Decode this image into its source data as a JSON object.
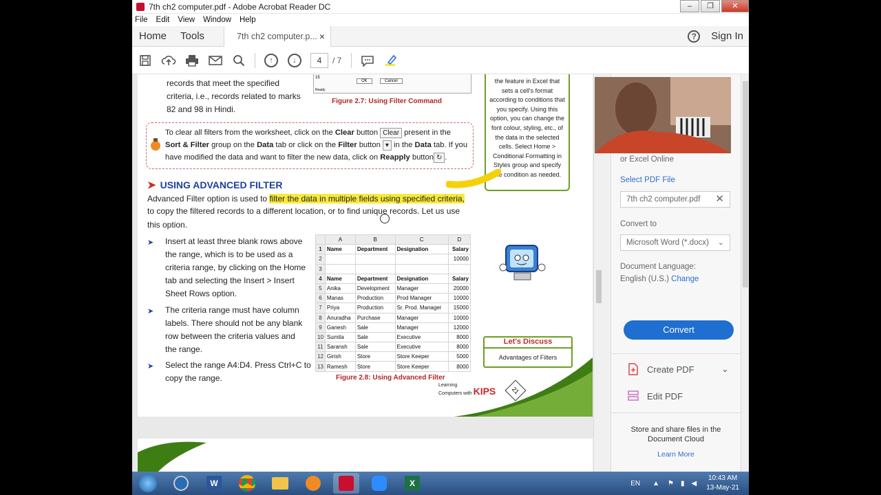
{
  "window": {
    "title": "7th ch2 computer.pdf - Adobe Acrobat Reader DC",
    "min": "–",
    "max": "❐",
    "close": "✕"
  },
  "menu": [
    "File",
    "Edit",
    "View",
    "Window",
    "Help"
  ],
  "tabs": {
    "home": "Home",
    "tools": "Tools",
    "doc_tab": "7th ch2 computer.p...",
    "doc_tab_close": "×",
    "help": "?",
    "sign_in": "Sign In"
  },
  "toolbar": {
    "page_current": "4",
    "page_total": "/ 7"
  },
  "document": {
    "top_lines": [
      "records that meet the specified",
      "criteria, i.e., records related to marks",
      "82 and 98 in Hindi."
    ],
    "fig27_caption": "Figure 2.7:  Using Filter Command",
    "fig27_ok": "OK",
    "fig27_cancel": "Cancel",
    "fig27_row": "15",
    "fig27_ready": "Ready",
    "tip": {
      "line1_a": "To clear all filters from the worksheet, click on the ",
      "line1_b": "Clear",
      "line1_c": " button ",
      "clear_chip": "Clear",
      "line1_d": " present in the",
      "line2_a": "Sort & Filter",
      "line2_b": " group on the ",
      "line2_c": "Data",
      "line2_d": " tab or click on the ",
      "line2_e": "Filter",
      "line2_f": " button ",
      "line2_g": " in the ",
      "line2_h": "Data",
      "line2_i": " tab. If you",
      "line3_a": "have modified the data and want to filter the new data, click on ",
      "line3_b": "Reapply",
      "line3_c": " button",
      "line3_d": "."
    },
    "heading": "USING ADVANCED FILTER",
    "para_a": "Advanced Filter option is used to ",
    "para_hl": "filter the data in multiple fields using specified criteria,",
    "para_b": "to copy the filtered records to a different location, or to find unique records. Let us use",
    "para_c": "this option.",
    "bullet1": [
      "Insert at least three blank rows above",
      "the range, which is to be used as a",
      "criteria range, by clicking on the Home",
      "tab and selecting the Insert > Insert",
      "Sheet Rows option."
    ],
    "bullet2": [
      "The criteria range must have column",
      "labels. There should not be any blank",
      "row between the criteria values and",
      "the range."
    ],
    "bullet3": [
      "Select the range A4:D4. Press Ctrl+C to",
      "copy the range."
    ],
    "fig28_caption": "Figure 2.8:  Using Advanced Filter",
    "sidebox": "the feature in Excel that sets a cell's format according to conditions that you specify. Using this option, you can change the font colour, styling, etc., of the data in the selected cells. Select Home > Conditional Formatting in Styles group and specify the condition as needed.",
    "discuss_title": "Let's Discuss",
    "discuss_body": "Advantages of Filters",
    "footer_brand_a": "Learning",
    "footer_brand_b": "Computers with",
    "footer_brand_c": "KIPS",
    "page_no": "21"
  },
  "excel": {
    "cols": [
      "",
      "A",
      "B",
      "C",
      "D"
    ],
    "rows": [
      [
        "1",
        "Name",
        "Department",
        "Designation",
        "Salary"
      ],
      [
        "2",
        "",
        "",
        "",
        "10000"
      ],
      [
        "3",
        "",
        "",
        "",
        ""
      ],
      [
        "4",
        "Name",
        "Department",
        "Designation",
        "Salary"
      ],
      [
        "5",
        "Anika",
        "Development",
        "Manager",
        "20000"
      ],
      [
        "6",
        "Manas",
        "Production",
        "Prod Manager",
        "10000"
      ],
      [
        "7",
        "Priya",
        "Production",
        "Sr. Prod. Manager",
        "15000"
      ],
      [
        "8",
        "Anuradha",
        "Purchase",
        "Manager",
        "10000"
      ],
      [
        "9",
        "Ganesh",
        "Sale",
        "Manager",
        "12000"
      ],
      [
        "10",
        "Sumita",
        "Sale",
        "Executive",
        "8000"
      ],
      [
        "11",
        "Saransh",
        "Sale",
        "Executive",
        "8000"
      ],
      [
        "12",
        "Girish",
        "Store",
        "Store Keeper",
        "5000"
      ],
      [
        "13",
        "Ramesh",
        "Store",
        "Store Keeper",
        "8000"
      ]
    ]
  },
  "right_panel": {
    "excel_online": "or Excel Online",
    "select_pdf": "Select PDF File",
    "file_name": "7th ch2 computer.pdf",
    "convert_to": "Convert to",
    "format": "Microsoft Word (*.docx)",
    "doc_lang_label": "Document Language:",
    "doc_lang": "English (U.S.)",
    "change": "Change",
    "convert_btn": "Convert",
    "create_pdf": "Create PDF",
    "edit_pdf": "Edit PDF",
    "store_a": "Store and share files in the",
    "store_b": "Document Cloud",
    "learn_more": "Learn More"
  },
  "taskbar": {
    "lang": "EN",
    "time": "10:43 AM",
    "date": "13-May-21"
  },
  "colors": {
    "highlight": "#f7ea3b",
    "heading_blue": "#1f3f99",
    "convert_blue": "#1f6fd1",
    "green": "#6b9e23"
  }
}
